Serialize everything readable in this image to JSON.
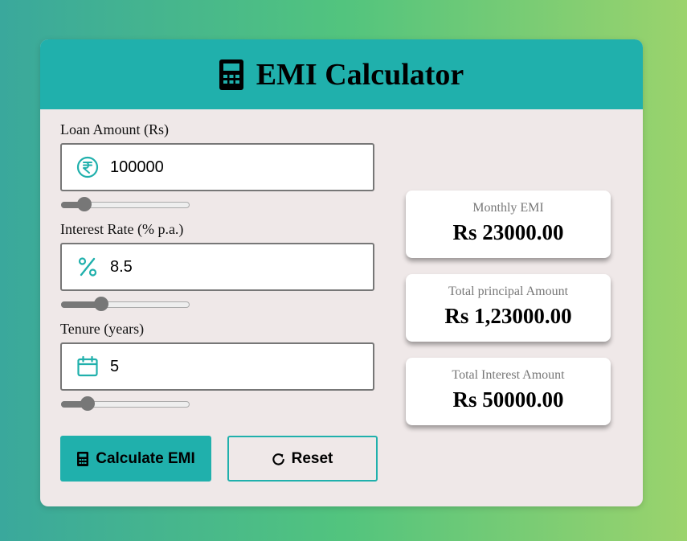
{
  "header": {
    "title": "EMI Calculator",
    "icon": "calculator-icon"
  },
  "form": {
    "loan": {
      "label": "Loan Amount (Rs)",
      "value": "100000",
      "icon": "rupee-icon",
      "slider_level": 0.14
    },
    "rate": {
      "label": "Interest Rate (% p.a.)",
      "value": "8.5",
      "icon": "percent-icon",
      "slider_level": 0.29
    },
    "tenure": {
      "label": "Tenure (years)",
      "value": "5",
      "icon": "calendar-icon",
      "slider_level": 0.17
    }
  },
  "buttons": {
    "calculate": "Calculate EMI",
    "reset": "Reset"
  },
  "results": [
    {
      "label": "Monthly EMI",
      "value": "Rs 23000.00"
    },
    {
      "label": "Total principal Amount",
      "value": "Rs 1,23000.00"
    },
    {
      "label": "Total Interest Amount",
      "value": "Rs 50000.00"
    }
  ],
  "colors": {
    "accent": "#20b0ac",
    "card_bg": "#efe8e8",
    "slider": "#777777"
  }
}
